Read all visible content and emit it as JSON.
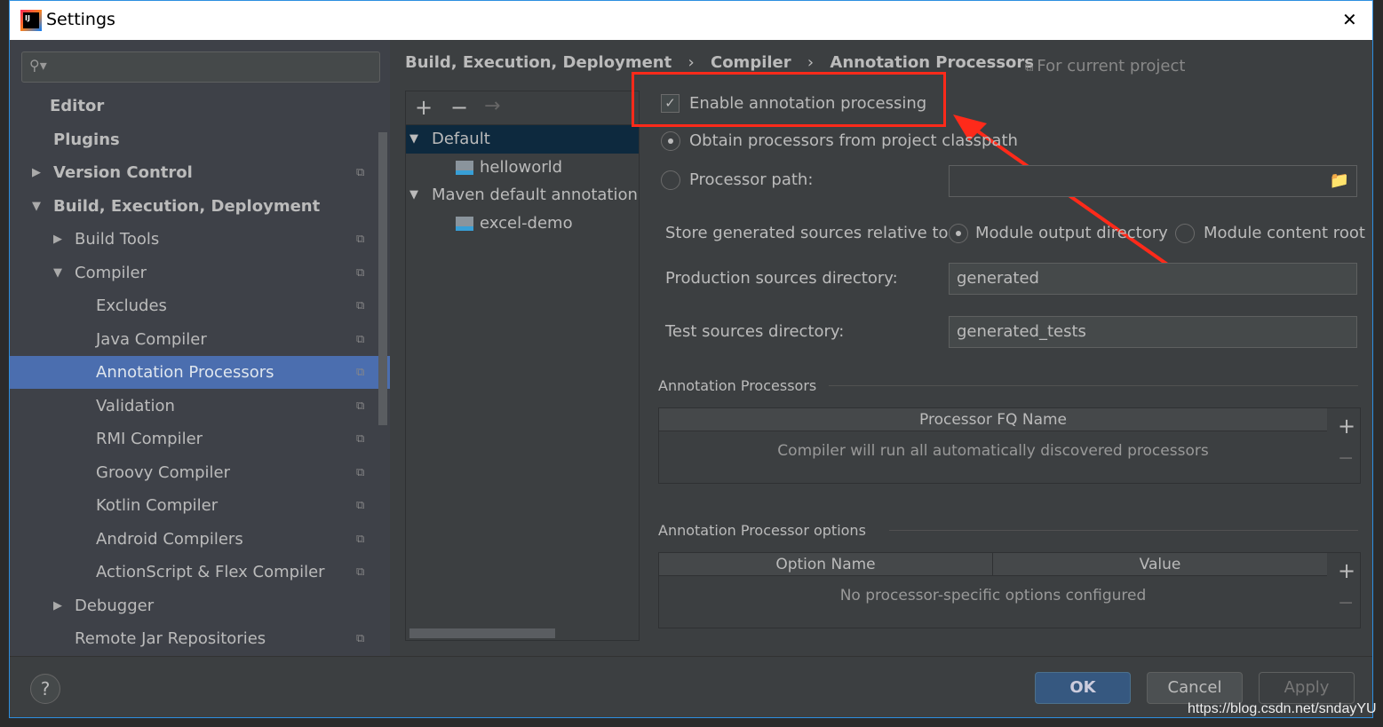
{
  "window": {
    "title": "Settings",
    "close": "✕"
  },
  "search": {
    "placeholder": ""
  },
  "sidebar": {
    "items": [
      {
        "label": "Editor",
        "bold": true
      },
      {
        "label": "Plugins",
        "bold": true
      },
      {
        "label": "Version Control",
        "bold": true,
        "arrow": "▶"
      },
      {
        "label": "Build, Execution, Deployment",
        "bold": true,
        "arrow": "▼"
      },
      {
        "label": "Build Tools",
        "arrow": "▶"
      },
      {
        "label": "Compiler",
        "arrow": "▼"
      },
      {
        "label": "Excludes"
      },
      {
        "label": "Java Compiler"
      },
      {
        "label": "Annotation Processors",
        "selected": true
      },
      {
        "label": "Validation"
      },
      {
        "label": "RMI Compiler"
      },
      {
        "label": "Groovy Compiler"
      },
      {
        "label": "Kotlin Compiler"
      },
      {
        "label": "Android Compilers"
      },
      {
        "label": "ActionScript & Flex Compiler"
      },
      {
        "label": "Debugger",
        "arrow": "▶"
      },
      {
        "label": "Remote Jar Repositories"
      }
    ]
  },
  "breadcrumb": {
    "items": [
      "Build, Execution, Deployment",
      "Compiler",
      "Annotation Processors"
    ],
    "scope": "For current project"
  },
  "tree": {
    "toolbar": [
      "+",
      "−",
      "→"
    ],
    "items": [
      {
        "label": "Default",
        "level": 0,
        "arrow": "▼",
        "selected": true
      },
      {
        "label": "helloworld",
        "level": 1
      },
      {
        "label": "Maven default annotation p",
        "level": 0,
        "arrow": "▼"
      },
      {
        "label": "excel-demo",
        "level": 1
      }
    ]
  },
  "form": {
    "enable_label": "Enable annotation processing",
    "enable_checked": true,
    "obtain_label": "Obtain processors from project classpath",
    "path_label": "Processor path:",
    "path_value": "",
    "store_label": "Store generated sources relative to:",
    "store_opt1": "Module output directory",
    "store_opt2": "Module content root",
    "prod_label": "Production sources directory:",
    "prod_value": "generated",
    "test_label": "Test sources directory:",
    "test_value": "generated_tests"
  },
  "processors": {
    "title": "Annotation Processors",
    "header": "Processor FQ Name",
    "empty": "Compiler will run all automatically discovered processors"
  },
  "options": {
    "title": "Annotation Processor options",
    "headers": [
      "Option Name",
      "Value"
    ],
    "empty": "No processor-specific options configured"
  },
  "footer": {
    "help": "?",
    "ok": "OK",
    "cancel": "Cancel",
    "apply": "Apply"
  },
  "watermark": "https://blog.csdn.net/sndayYU",
  "colors": {
    "accent": "#4b6eaf",
    "annotation": "#ff2a1a"
  }
}
